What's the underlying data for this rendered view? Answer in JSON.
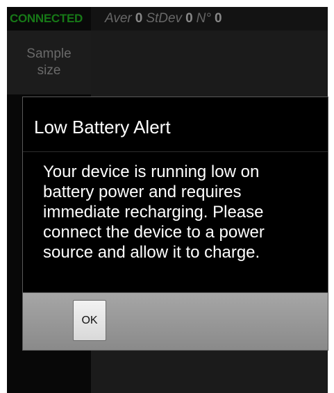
{
  "status_bar": {
    "connection": "CONNECTED",
    "average_label": "Aver",
    "average_value": "0",
    "stdev_label": "StDev",
    "stdev_value": "0",
    "count_label": "N°",
    "count_value": "0"
  },
  "sidebar": {
    "sample_size_line1": "Sample",
    "sample_size_line2": "size"
  },
  "dialog": {
    "title": "Low Battery Alert",
    "message": "Your device is running low on battery power and requires immediate recharging. Please connect the device to a power source and allow it to charge.",
    "ok_label": "OK"
  },
  "colors": {
    "connected": "#1fa01f",
    "dialog_background": "#000000",
    "button_bar": "#9a9a9a"
  }
}
